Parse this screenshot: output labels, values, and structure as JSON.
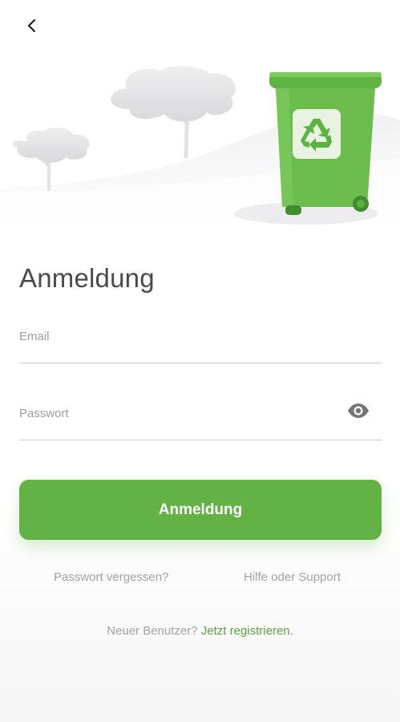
{
  "page": {
    "title": "Anmeldung"
  },
  "icons": {
    "back": "chevron-left-icon",
    "password_toggle": "eye-icon",
    "recycle": "recycle-icon"
  },
  "form": {
    "email": {
      "placeholder": "Email",
      "value": ""
    },
    "password": {
      "placeholder": "Passwort",
      "value": ""
    },
    "submit_label": "Anmeldung"
  },
  "links": {
    "forgot_password": "Passwort vergessen?",
    "help_support": "Hilfe oder Support"
  },
  "register": {
    "prompt": "Neuer Benutzer?",
    "link": "Jetzt registrieren."
  },
  "colors": {
    "accent": "#63b245",
    "bin": "#6cbd4e",
    "text": "#4a4a4a",
    "muted": "#a3a3a3"
  }
}
